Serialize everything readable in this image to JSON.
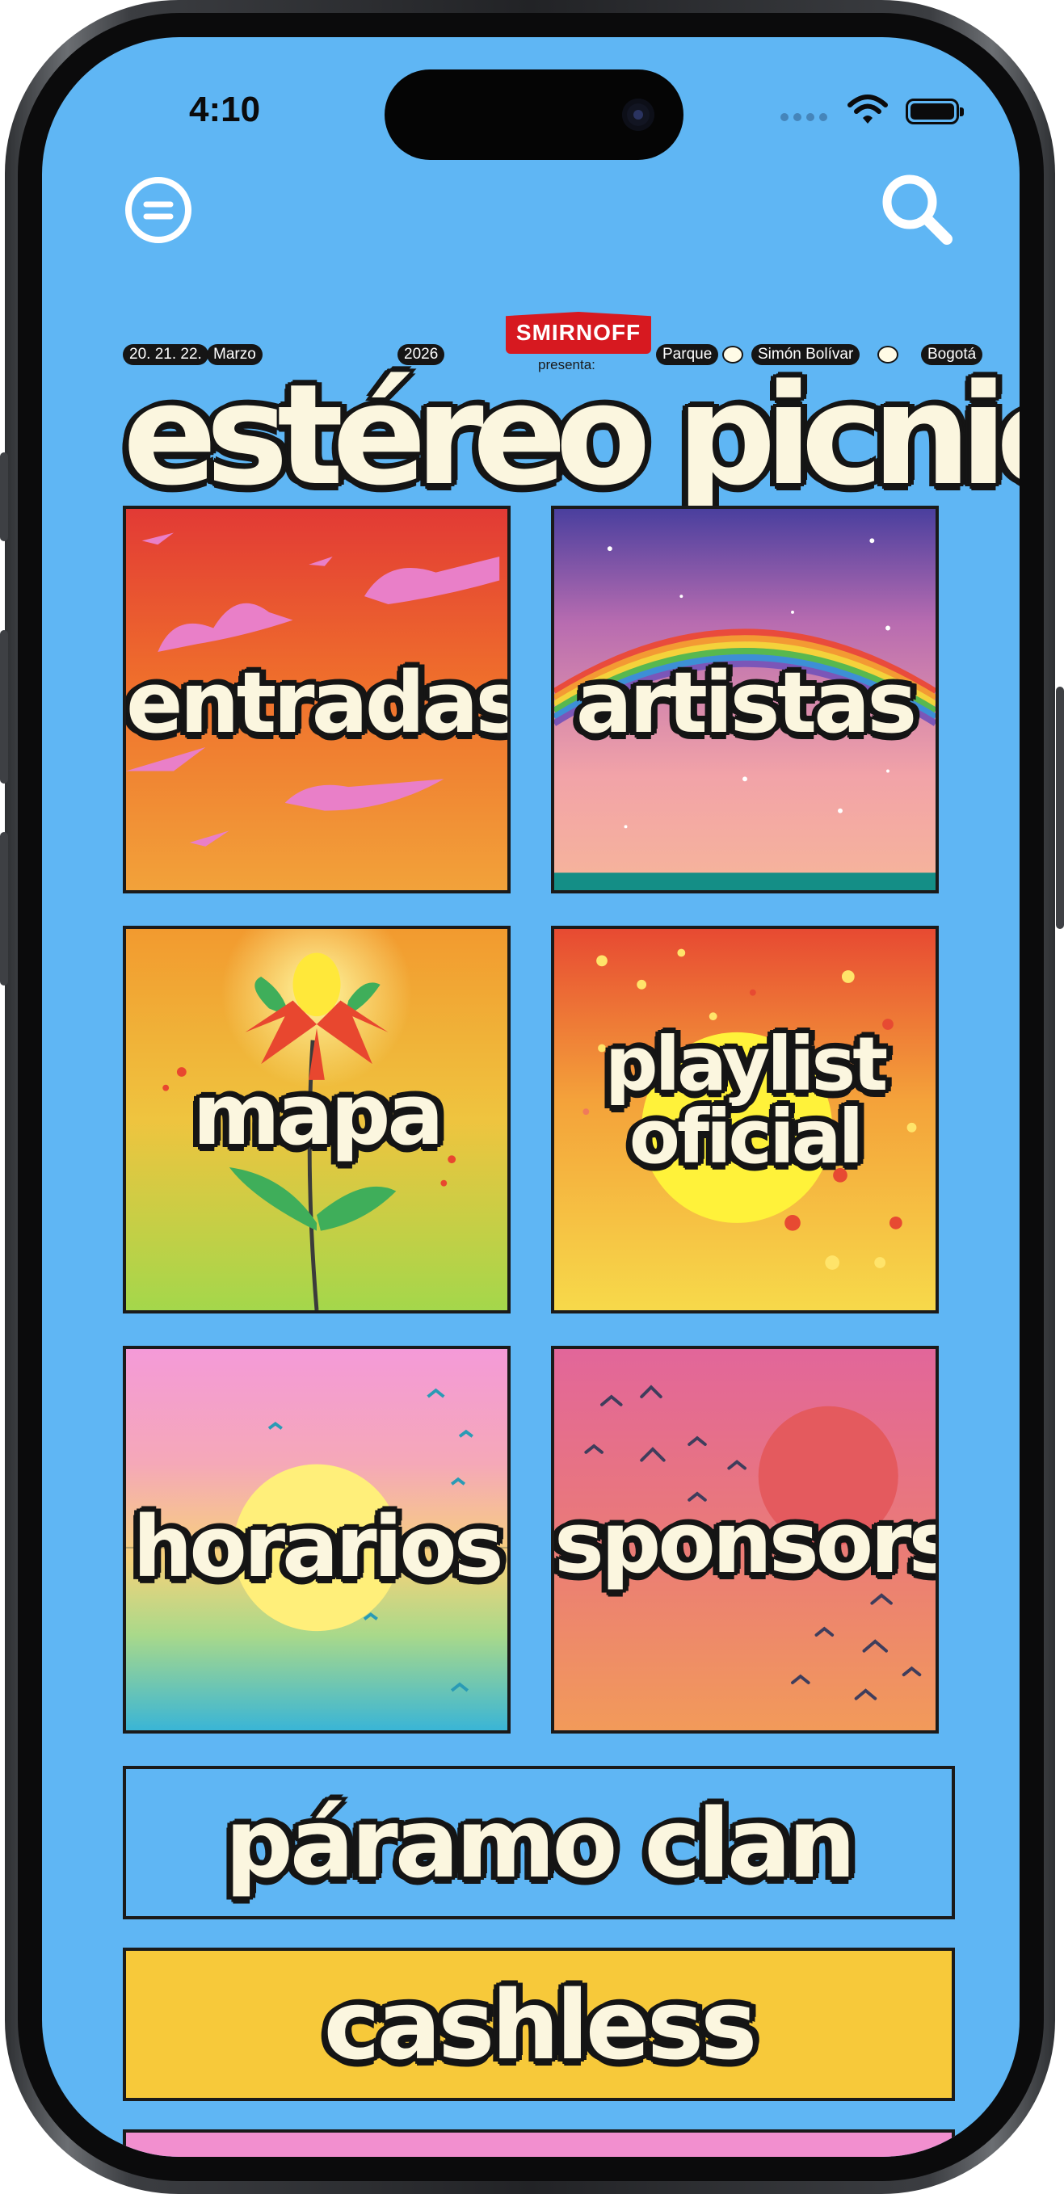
{
  "status_bar": {
    "time": "4:10"
  },
  "header": {
    "menu_icon": "menu-icon",
    "search_icon": "search-icon",
    "dates": "20. 21. 22.",
    "month": "Marzo",
    "year": "2026",
    "sponsor_logo": "SMIRNOFF",
    "presenta": "presenta:",
    "venue": [
      "Parque",
      "Simón Bolívar",
      "Bogotá"
    ],
    "title": "estéreo picnic"
  },
  "tiles": [
    {
      "label": "entradas"
    },
    {
      "label": "artistas"
    },
    {
      "label": "mapa"
    },
    {
      "label_line1": "playlist",
      "label_line2": "oficial"
    },
    {
      "label": "horarios"
    },
    {
      "label": "sponsors"
    }
  ],
  "wide_buttons": [
    {
      "label": "páramo clan",
      "color": "#5fb6f4"
    },
    {
      "label": "cashless",
      "color": "#f7c93a"
    }
  ],
  "colors": {
    "background": "#5fb6f4",
    "outline": "#1a1a1a",
    "lettering": "#fbf6df",
    "accent_red": "#d71920",
    "cashless_yellow": "#f7c93a",
    "peek_pink": "#f28fcf"
  }
}
